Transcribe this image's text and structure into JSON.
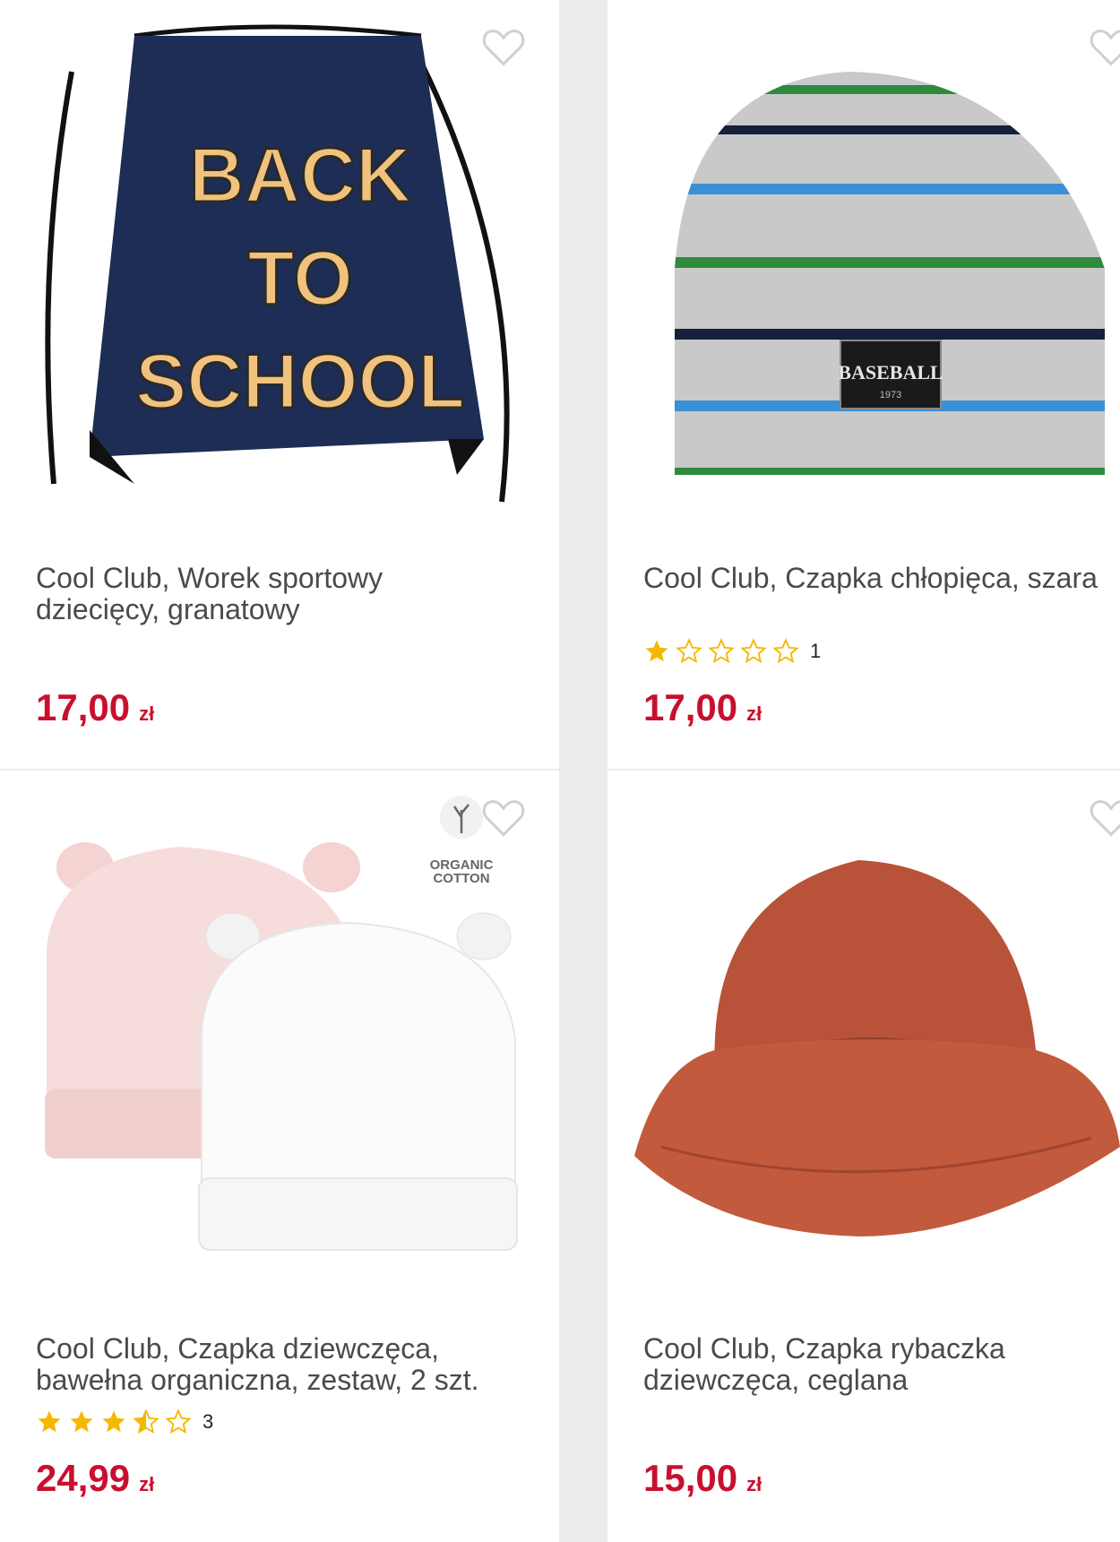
{
  "products": [
    {
      "title": "Cool Club, Worek sportowy\ndziecięcy, granatowy",
      "price": "17,00",
      "currency": "zł",
      "image_text": [
        "BACK",
        "TO",
        "SCHOOL"
      ]
    },
    {
      "title": "Cool Club, Czapka chłopięca, szara",
      "rating": 1,
      "rating_count": "1",
      "price": "17,00",
      "currency": "zł",
      "image_text": [
        "BASEBALL",
        "1973"
      ]
    },
    {
      "title": "Cool Club, Czapka dziewczęca,\nbawełna organiczna, zestaw, 2 szt.",
      "rating": 3.5,
      "rating_count": "3",
      "price": "24,99",
      "currency": "zł",
      "badge": "ORGANIC\nCOTTON"
    },
    {
      "title": "Cool Club, Czapka rybaczka\ndziewczęca, ceglana",
      "price": "15,00",
      "currency": "zł"
    }
  ],
  "colors": {
    "price": "#c8102e",
    "star": "#f5b800",
    "title": "#4a4a4a"
  },
  "icons": {
    "wishlist": "heart-outline-icon",
    "rating": "star-icon"
  }
}
